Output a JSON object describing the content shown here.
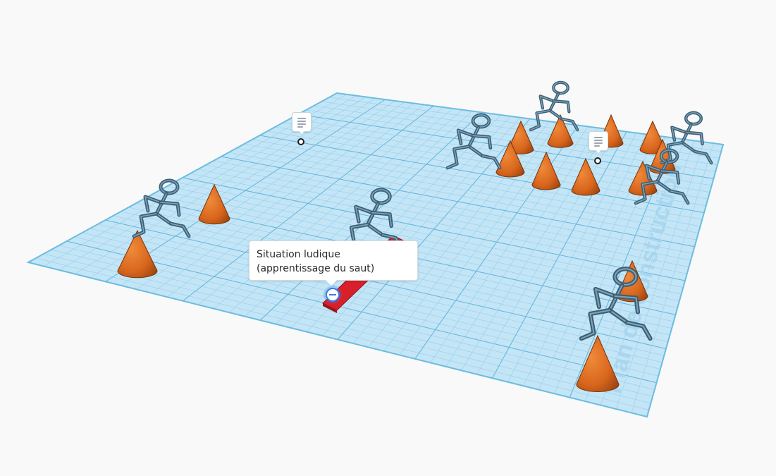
{
  "workplane": {
    "watermark": "Plan de construction",
    "colors": {
      "plane": "#bfe3f5",
      "grid_minor": "#8fcbe8",
      "grid_major": "#5fb2dc",
      "border": "#6cbde0",
      "background": "#f9f9f9"
    }
  },
  "objects": {
    "cone_color": "#d8661d",
    "figure_color": "#4d6f84",
    "ramp_color": "#d9202a"
  },
  "notes": [
    {
      "name": "note-1",
      "icon": "note-icon"
    },
    {
      "name": "note-2",
      "icon": "note-icon"
    }
  ],
  "tooltip": {
    "text": "Situation ludique (apprentissage du saut)"
  }
}
